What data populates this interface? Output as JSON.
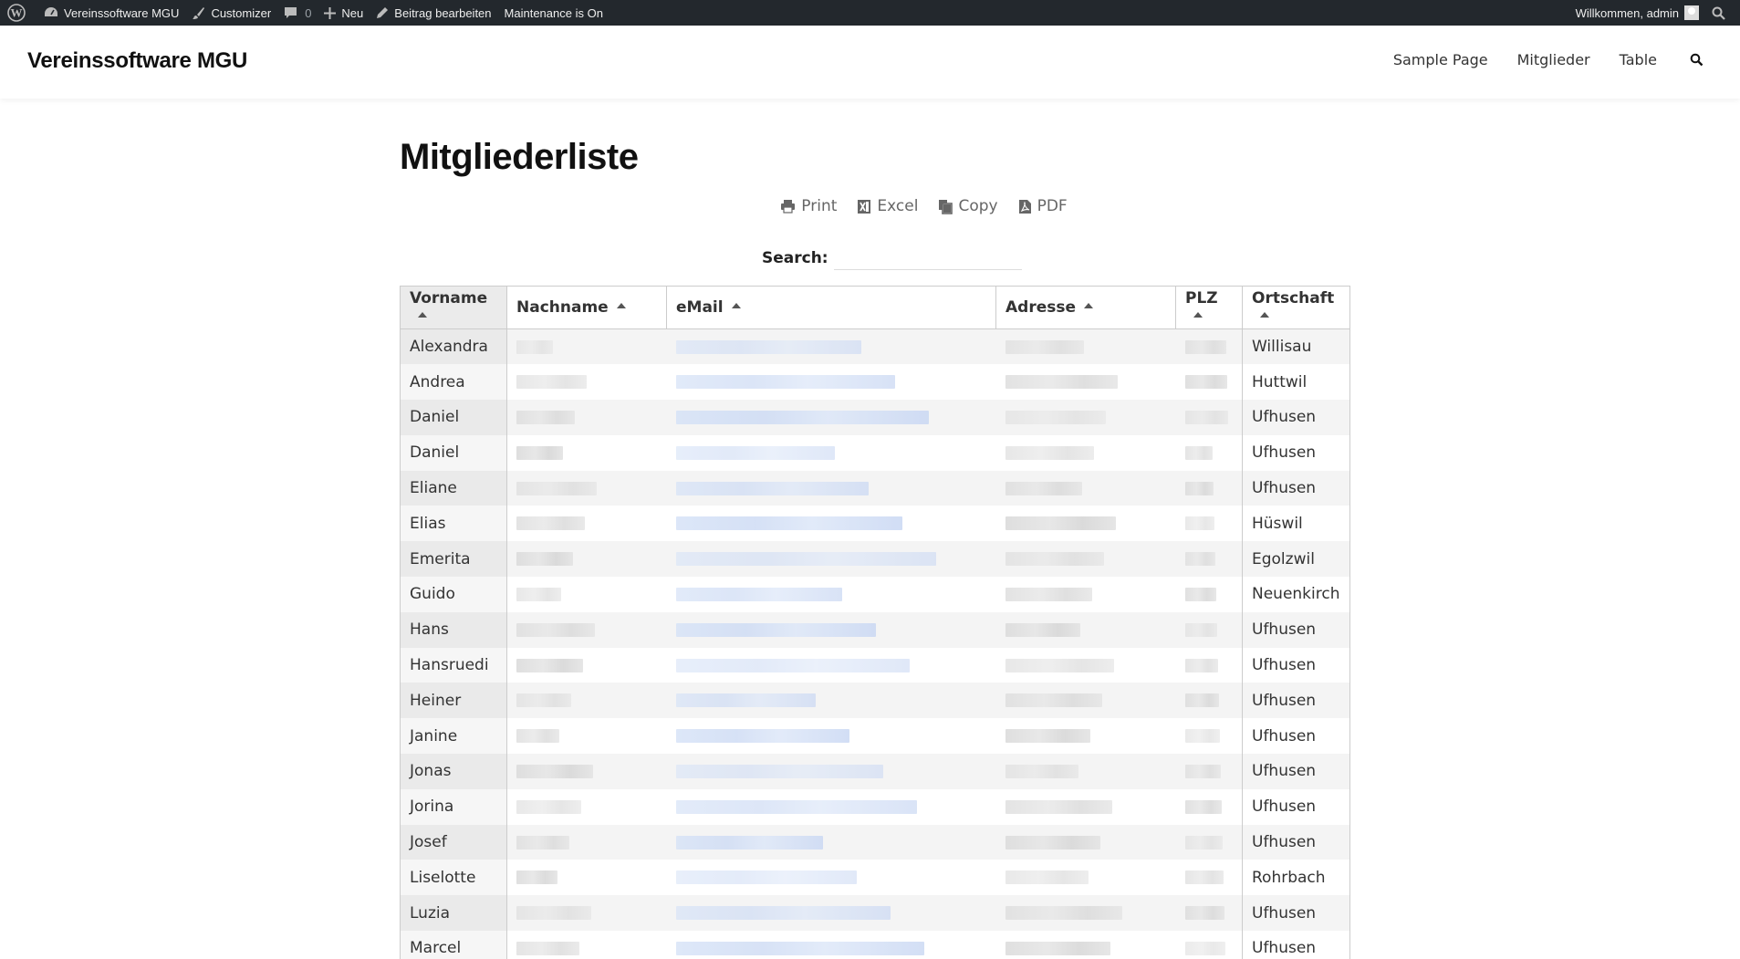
{
  "adminbar": {
    "site": "Vereinssoftware MGU",
    "customizer": "Customizer",
    "comments_count": "0",
    "new": "Neu",
    "edit_post": "Beitrag bearbeiten",
    "maintenance": "Maintenance is On",
    "welcome": "Willkommen, admin"
  },
  "header": {
    "site_title": "Vereinssoftware MGU",
    "nav": [
      "Sample Page",
      "Mitglieder",
      "Table"
    ]
  },
  "page": {
    "title": "Mitgliederliste",
    "exports": [
      "Print",
      "Excel",
      "Copy",
      "PDF"
    ],
    "search_label": "Search:",
    "search_value": ""
  },
  "table": {
    "columns": [
      "Vorname",
      "Nachname",
      "eMail",
      "Adresse",
      "PLZ",
      "Ortschaft"
    ],
    "sorted_column": "Vorname",
    "rows": [
      {
        "vorname": "Alexandra",
        "ortschaft": "Willisau"
      },
      {
        "vorname": "Andrea",
        "ortschaft": "Huttwil"
      },
      {
        "vorname": "Daniel",
        "ortschaft": "Ufhusen"
      },
      {
        "vorname": "Daniel",
        "ortschaft": "Ufhusen"
      },
      {
        "vorname": "Eliane",
        "ortschaft": "Ufhusen"
      },
      {
        "vorname": "Elias",
        "ortschaft": "Hüswil"
      },
      {
        "vorname": "Emerita",
        "ortschaft": "Egolzwil"
      },
      {
        "vorname": "Guido",
        "ortschaft": "Neuenkirch"
      },
      {
        "vorname": "Hans",
        "ortschaft": "Ufhusen"
      },
      {
        "vorname": "Hansruedi",
        "ortschaft": "Ufhusen"
      },
      {
        "vorname": "Heiner",
        "ortschaft": "Ufhusen"
      },
      {
        "vorname": "Janine",
        "ortschaft": "Ufhusen"
      },
      {
        "vorname": "Jonas",
        "ortschaft": "Ufhusen"
      },
      {
        "vorname": "Jorina",
        "ortschaft": "Ufhusen"
      },
      {
        "vorname": "Josef",
        "ortschaft": "Ufhusen"
      },
      {
        "vorname": "Liselotte",
        "ortschaft": "Rohrbach"
      },
      {
        "vorname": "Luzia",
        "ortschaft": "Ufhusen"
      },
      {
        "vorname": "Marcel",
        "ortschaft": "Ufhusen"
      }
    ]
  },
  "colors": {
    "adminbar_bg": "#23282d",
    "sorted_header_bg": "#ebebeb",
    "text": "#333333"
  }
}
